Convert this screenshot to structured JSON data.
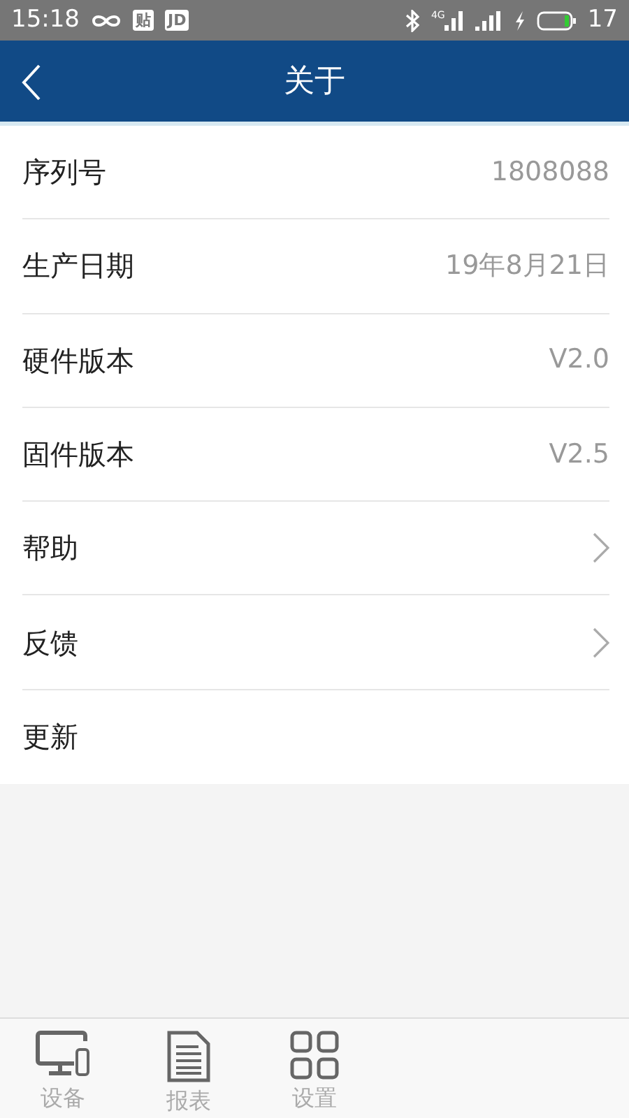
{
  "status_bar": {
    "time": "15:18",
    "app_badges": [
      "贴",
      "JD"
    ],
    "network": "4G",
    "battery": "17"
  },
  "header": {
    "title": "关于"
  },
  "rows": [
    {
      "kind": "value",
      "label": "序列号",
      "value": "1808088"
    },
    {
      "kind": "value",
      "label": "生产日期",
      "value": "19年8月21日"
    },
    {
      "kind": "value",
      "label": "硬件版本",
      "value": "V2.0"
    },
    {
      "kind": "value",
      "label": "固件版本",
      "value": "V2.5"
    },
    {
      "kind": "link",
      "label": "帮助"
    },
    {
      "kind": "link",
      "label": "反馈"
    },
    {
      "kind": "plain",
      "label": "更新"
    }
  ],
  "tab_bar": [
    {
      "kind": "device",
      "label": "设备"
    },
    {
      "kind": "report",
      "label": "报表"
    },
    {
      "kind": "grid",
      "label": "设置"
    }
  ]
}
